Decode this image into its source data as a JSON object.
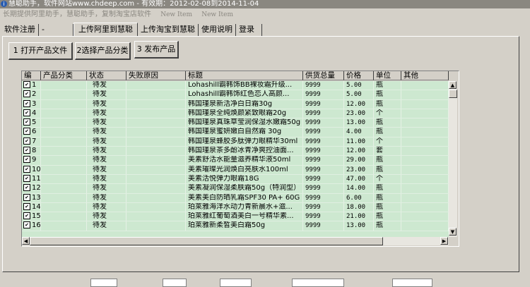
{
  "window": {
    "title": "慧聪助手，软件网站www.chdeep.com - 有效期：2012-02-08到2014-11-04"
  },
  "menu": {
    "items": [
      "长期提供阿里助手，慧聪助手，复制淘宝店软件",
      "New Item",
      "New Item"
    ]
  },
  "tabs": [
    {
      "label": "软件注册"
    },
    {
      "label": "-"
    },
    {
      "label": "上传阿里到慧聪",
      "active": true
    },
    {
      "label": "上传淘宝到慧聪"
    },
    {
      "label": "使用说明"
    },
    {
      "label": "登录"
    }
  ],
  "buttons": {
    "open": "1 打开产品文件",
    "category": "2选择产品分类",
    "publish": "3 发布产品"
  },
  "table": {
    "columns": [
      "编",
      "产品分类",
      "状态",
      "失败原因",
      "标题",
      "供货总量",
      "价格",
      "单位",
      "其他"
    ],
    "rows": [
      {
        "no": "1",
        "status": "待发",
        "title": "Lohashill霸韩饰BB裸妆霜升级...",
        "qty": "9999",
        "price": "5.00",
        "unit": "瓶"
      },
      {
        "no": "2",
        "status": "待发",
        "title": "Lohashill霸韩饰红色恋人高颜...",
        "qty": "9999",
        "price": "5.00",
        "unit": "瓶"
      },
      {
        "no": "3",
        "status": "待发",
        "title": "韩国瑾泉新活净白日霜30g",
        "qty": "9999",
        "price": "12.00",
        "unit": "瓶"
      },
      {
        "no": "4",
        "status": "待发",
        "title": "韩国瑾泉全纯焕颜紧致眼霜20g",
        "qty": "9999",
        "price": "23.00",
        "unit": "个"
      },
      {
        "no": "5",
        "status": "待发",
        "title": "韩国瑾泉真珠草莹润保湿水嫩霜50g",
        "qty": "9999",
        "price": "13.00",
        "unit": "瓶"
      },
      {
        "no": "6",
        "status": "待发",
        "title": "韩国瑾泉蜜妍嫩白自然霜 30g",
        "qty": "9999",
        "price": "4.00",
        "unit": "瓶"
      },
      {
        "no": "7",
        "status": "待发",
        "title": "韩国瑾泉蜂胶多肽弹力眼精华30ml",
        "qty": "9999",
        "price": "11.00",
        "unit": "个"
      },
      {
        "no": "8",
        "status": "待发",
        "title": "韩国瑾泉茶多酚冰青净爽控油面...",
        "qty": "9999",
        "price": "12.00",
        "unit": "套"
      },
      {
        "no": "9",
        "status": "待发",
        "title": "美素舒活水能量滋养精华液50ml",
        "qty": "9999",
        "price": "29.00",
        "unit": "瓶"
      },
      {
        "no": "10",
        "status": "待发",
        "title": "美素璀璨光润焕白亮肤水100ml",
        "qty": "9999",
        "price": "23.00",
        "unit": "瓶"
      },
      {
        "no": "11",
        "status": "待发",
        "title": "美素活悦弹力眼霜18G",
        "qty": "9999",
        "price": "47.00",
        "unit": "个"
      },
      {
        "no": "12",
        "status": "待发",
        "title": "美素凝润保湿柔肤霜50g（特润型）",
        "qty": "9999",
        "price": "14.00",
        "unit": "瓶"
      },
      {
        "no": "13",
        "status": "待发",
        "title": "美素美白防晒乳霜SPF30  PA+ 60G",
        "qty": "9999",
        "price": "6.00",
        "unit": "瓶"
      },
      {
        "no": "14",
        "status": "待发",
        "title": "珀莱雅海洋水动力青新晨水+滋...",
        "qty": "9999",
        "price": "18.00",
        "unit": "瓶"
      },
      {
        "no": "15",
        "status": "待发",
        "title": "珀莱雅红葡萄酒美白一号精华素...",
        "qty": "9999",
        "price": "21.00",
        "unit": "瓶"
      },
      {
        "no": "16",
        "status": "待发",
        "title": "珀莱雅新柔皙美白霜50g",
        "qty": "9999",
        "price": "13.00",
        "unit": "瓶"
      }
    ]
  },
  "colors": {
    "row_bg": "#cde8d0",
    "window_bg": "#d4d0c8"
  }
}
